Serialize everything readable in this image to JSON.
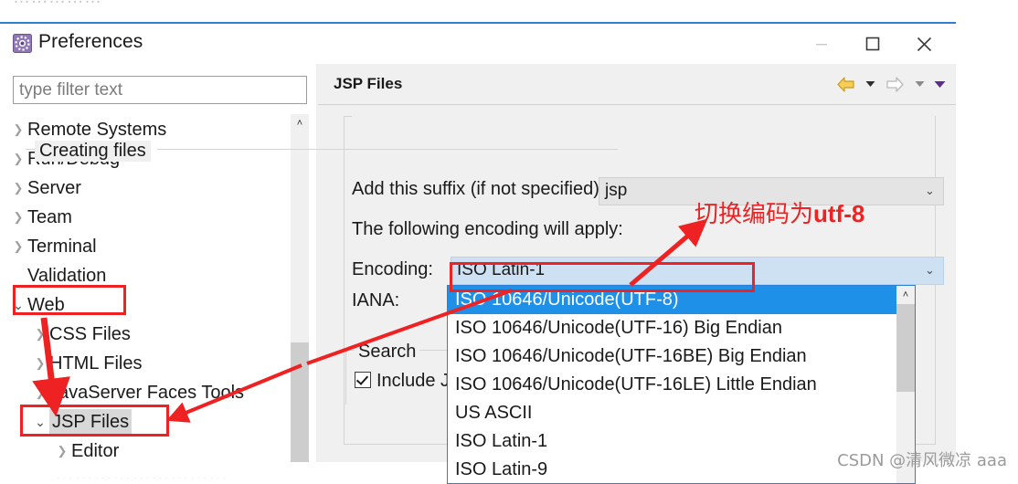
{
  "window": {
    "title": "Preferences",
    "app_icon": "preferences-gear-icon",
    "minimize_label": "—",
    "maximize_label": "□",
    "close_label": "✕"
  },
  "top_strip": {
    "ghost_text": "……………"
  },
  "bottom_strip": {
    "ghost_text": "………………………"
  },
  "left_panel": {
    "filter": {
      "placeholder": "type filter text",
      "value": ""
    },
    "tree": [
      {
        "label": "Remote Systems",
        "indent": 0,
        "twisty": "collapsed",
        "selected": false
      },
      {
        "label": "Run/Debug",
        "indent": 0,
        "twisty": "collapsed",
        "selected": false
      },
      {
        "label": "Server",
        "indent": 0,
        "twisty": "collapsed",
        "selected": false
      },
      {
        "label": "Team",
        "indent": 0,
        "twisty": "collapsed",
        "selected": false
      },
      {
        "label": "Terminal",
        "indent": 0,
        "twisty": "collapsed",
        "selected": false
      },
      {
        "label": "Validation",
        "indent": 0,
        "twisty": "none",
        "selected": false
      },
      {
        "label": "Web",
        "indent": 0,
        "twisty": "expanded",
        "selected": false
      },
      {
        "label": "CSS Files",
        "indent": 1,
        "twisty": "collapsed",
        "selected": false
      },
      {
        "label": "HTML Files",
        "indent": 1,
        "twisty": "collapsed",
        "selected": false
      },
      {
        "label": "JavaServer Faces Tools",
        "indent": 1,
        "twisty": "collapsed",
        "selected": false
      },
      {
        "label": "JSP Files",
        "indent": 1,
        "twisty": "expanded",
        "selected": true
      },
      {
        "label": "Editor",
        "indent": 2,
        "twisty": "collapsed",
        "selected": false
      }
    ],
    "scrollbar": {
      "up_arrow": "˄"
    }
  },
  "right_panel": {
    "page_title": "JSP Files",
    "nav": {
      "back_icon": "back-arrow-icon",
      "back_caret_icon": "caret-down-icon",
      "forward_icon": "forward-arrow-icon",
      "forward_caret_icon": "caret-down-icon",
      "menu_caret_icon": "caret-down-purple-icon"
    },
    "group_creating_files": {
      "legend": "Creating files",
      "suffix_label": "Add this suffix (if not specified):",
      "suffix_value": "jsp",
      "encoding_note": "The following encoding will apply:",
      "encoding_label": "Encoding:",
      "encoding_value": "ISO Latin-1",
      "iana_label": "IANA:",
      "iana_value": ""
    },
    "group_search": {
      "legend": "Search",
      "include_label": "Include J",
      "include_checked": true
    }
  },
  "encoding_dropdown": {
    "selected_index": 0,
    "options": [
      "ISO 10646/Unicode(UTF-8)",
      "ISO 10646/Unicode(UTF-16) Big Endian",
      "ISO 10646/Unicode(UTF-16BE) Big Endian",
      "ISO 10646/Unicode(UTF-16LE) Little Endian",
      "US ASCII",
      "ISO Latin-1",
      "ISO Latin-9"
    ],
    "scrollbar": {
      "up_arrow": "˄"
    }
  },
  "annotations": {
    "note_cn": "切换编码为",
    "note_latin": "utf-8",
    "highlight_color": "#ee2222",
    "boxes": [
      "Web",
      "JSP Files",
      "ISO 10646/Unicode(UTF-8)"
    ]
  },
  "watermark": {
    "text": "CSDN @清风微凉 aaa"
  }
}
